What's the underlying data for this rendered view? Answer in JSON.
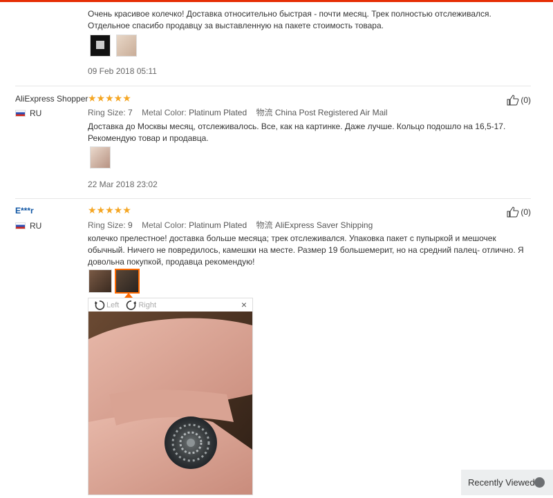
{
  "reviews": [
    {
      "text": "Очень красивое колечко! Доставка относительно быстрая - почти месяц. Трек полностью отслеживался. Отдельное спасибо продавцу за выставленную на пакете стоимость товара.",
      "date": "09 Feb 2018 05:11"
    },
    {
      "user": "AliExpress Shopper",
      "country": "RU",
      "stars": "★★★★★",
      "ring_size_label": "Ring Size:",
      "ring_size": "7",
      "metal_label": "Metal Color:",
      "metal": "Platinum Plated",
      "shipping_label": "物流",
      "shipping": "China Post Registered Air Mail",
      "text": "Доставка до Москвы месяц, отслеживалось. Все, как на картинке. Даже лучше. Кольцо подошло на 16,5-17. Рекомендую товар и продавца.",
      "date": "22 Mar 2018 23:02",
      "helpful": "(0)"
    },
    {
      "user": "E***r",
      "country": "RU",
      "stars": "★★★★★",
      "ring_size_label": "Ring Size:",
      "ring_size": "9",
      "metal_label": "Metal Color:",
      "metal": "Platinum Plated",
      "shipping_label": "物流",
      "shipping": "AliExpress Saver Shipping",
      "text": "колечко прелестное! доставка больше месяца; трек отслеживался. Упаковка пакет с пупыркой и мешочек обычный. Ничего не повредилось, камешки на месте. Размер 19 большемерит, но на средний палец- отлично. Я довольна покупкой, продавца рекомендую!",
      "helpful": "(0)"
    }
  ],
  "viewer": {
    "left_label": "Left",
    "right_label": "Right",
    "close": "×"
  },
  "recently_viewed": "Recently Viewed",
  "colors": {
    "accent": "#ff6a00",
    "star": "#f5a623",
    "link": "#0e55a3",
    "top_bar": "#e62e04"
  }
}
